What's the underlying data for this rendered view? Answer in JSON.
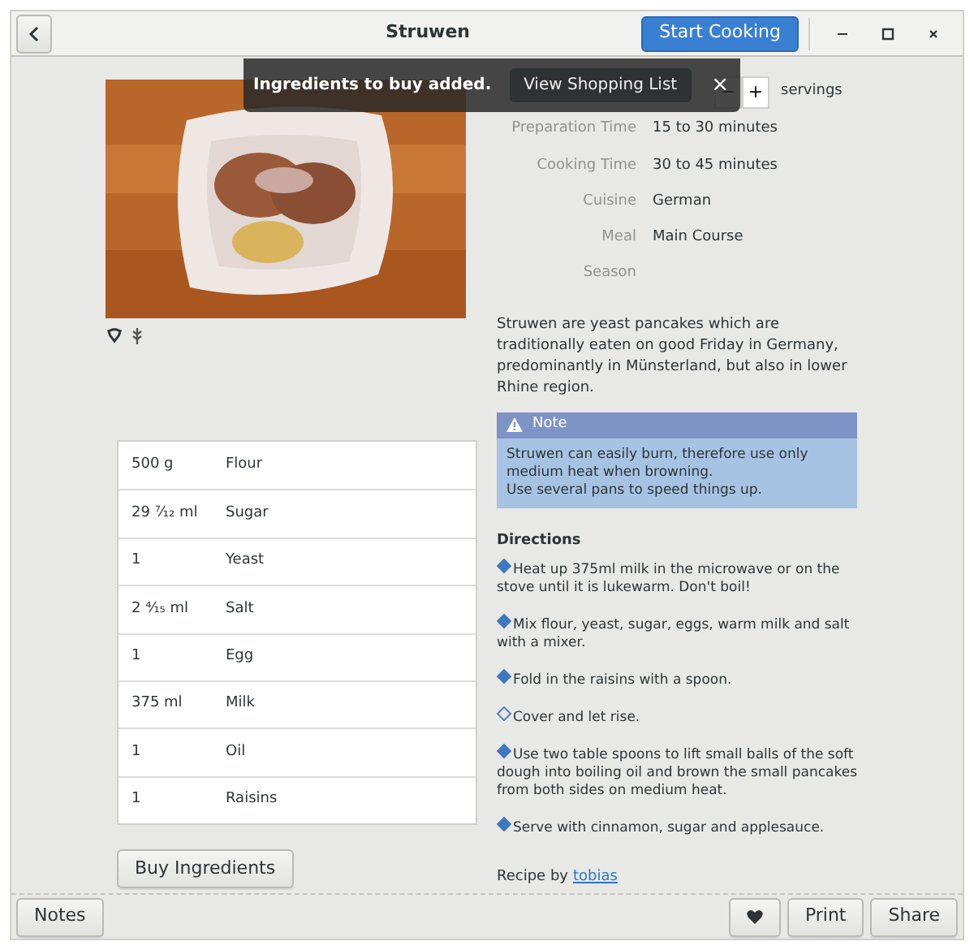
{
  "window": {
    "title": "Struwen",
    "primary_button": "Start Cooking"
  },
  "toast": {
    "message": "Ingredients to buy added.",
    "action": "View Shopping List",
    "close": "×"
  },
  "servings": {
    "minus": "−",
    "plus": "+",
    "label": "servings"
  },
  "details": [
    {
      "label": "Preparation Time",
      "value": "15 to 30 minutes"
    },
    {
      "label": "Cooking Time",
      "value": "30 to 45 minutes"
    },
    {
      "label": "Cuisine",
      "value": "German"
    },
    {
      "label": "Meal",
      "value": "Main Course"
    },
    {
      "label": "Season"
    }
  ],
  "description": "Struwen are yeast pancakes which are traditionally eaten on good Friday in Germany, predominantly in Münsterland, but also in lower Rhine region.",
  "note": {
    "title": "Note",
    "lines": [
      "Struwen can easily burn, therefore use only medium heat when browning.",
      "Use several pans to speed things up."
    ]
  },
  "ingredients": [
    {
      "amount": "500 g",
      "name": "Flour"
    },
    {
      "amount": "29 ⁷⁄₁₂ ml",
      "name": "Sugar"
    },
    {
      "amount": "1",
      "name": "Yeast"
    },
    {
      "amount": "2 ⁴⁄₁₅ ml",
      "name": "Salt"
    },
    {
      "amount": "1",
      "name": "Egg"
    },
    {
      "amount": "375 ml",
      "name": "Milk"
    },
    {
      "amount": "1",
      "name": "Oil"
    },
    {
      "amount": "1",
      "name": "Raisins"
    }
  ],
  "buy_button": "Buy Ingredients",
  "directions": {
    "title": "Directions",
    "steps": [
      {
        "text": "Heat up 375ml milk in the microwave or on the stove until it is lukewarm. Don't boil!",
        "filled": true
      },
      {
        "text": "Mix flour, yeast, sugar, eggs, warm milk and salt with a mixer.",
        "filled": true
      },
      {
        "text": "Fold in the raisins with a spoon.",
        "filled": true
      },
      {
        "text": "Cover and let rise.",
        "filled": false
      },
      {
        "text": "Use two table spoons to lift small balls of the soft dough into boiling oil and brown the small pancakes from both sides on medium heat.",
        "filled": true
      },
      {
        "text": "Serve with cinnamon, sugar and applesauce.",
        "filled": true
      }
    ]
  },
  "author": {
    "prefix": "Recipe by",
    "name": "tobias"
  },
  "bottom_bar": {
    "notes": "Notes",
    "print": "Print",
    "share": "Share"
  }
}
